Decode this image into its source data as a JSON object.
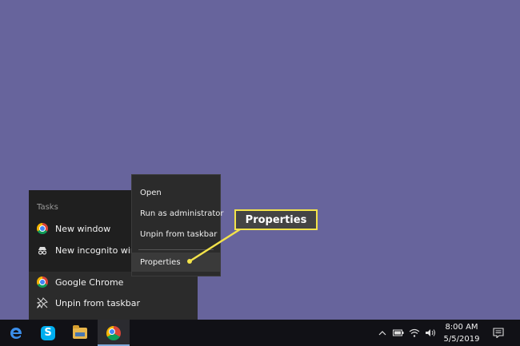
{
  "jumplist": {
    "tasks_header": "Tasks",
    "items": [
      {
        "label": "New window",
        "icon": "chrome-icon"
      },
      {
        "label": "New incognito window",
        "icon": "incognito-icon"
      }
    ],
    "app_items": [
      {
        "label": "Google Chrome",
        "icon": "chrome-icon"
      },
      {
        "label": "Unpin from taskbar",
        "icon": "unpin-icon"
      }
    ]
  },
  "context_menu": {
    "items": [
      "Open",
      "Run as administrator",
      "Unpin from taskbar"
    ],
    "highlighted": "Properties"
  },
  "callout": {
    "label": "Properties",
    "color": "#f3e34a"
  },
  "taskbar": {
    "apps": [
      "edge-icon",
      "skype-icon",
      "file-explorer-icon",
      "chrome-icon"
    ],
    "clock_time": "8:00 AM",
    "clock_date": "5/5/2019"
  },
  "colors": {
    "desktop": "#67649c",
    "taskbar": "#111116",
    "accent": "#7fa8d8"
  }
}
